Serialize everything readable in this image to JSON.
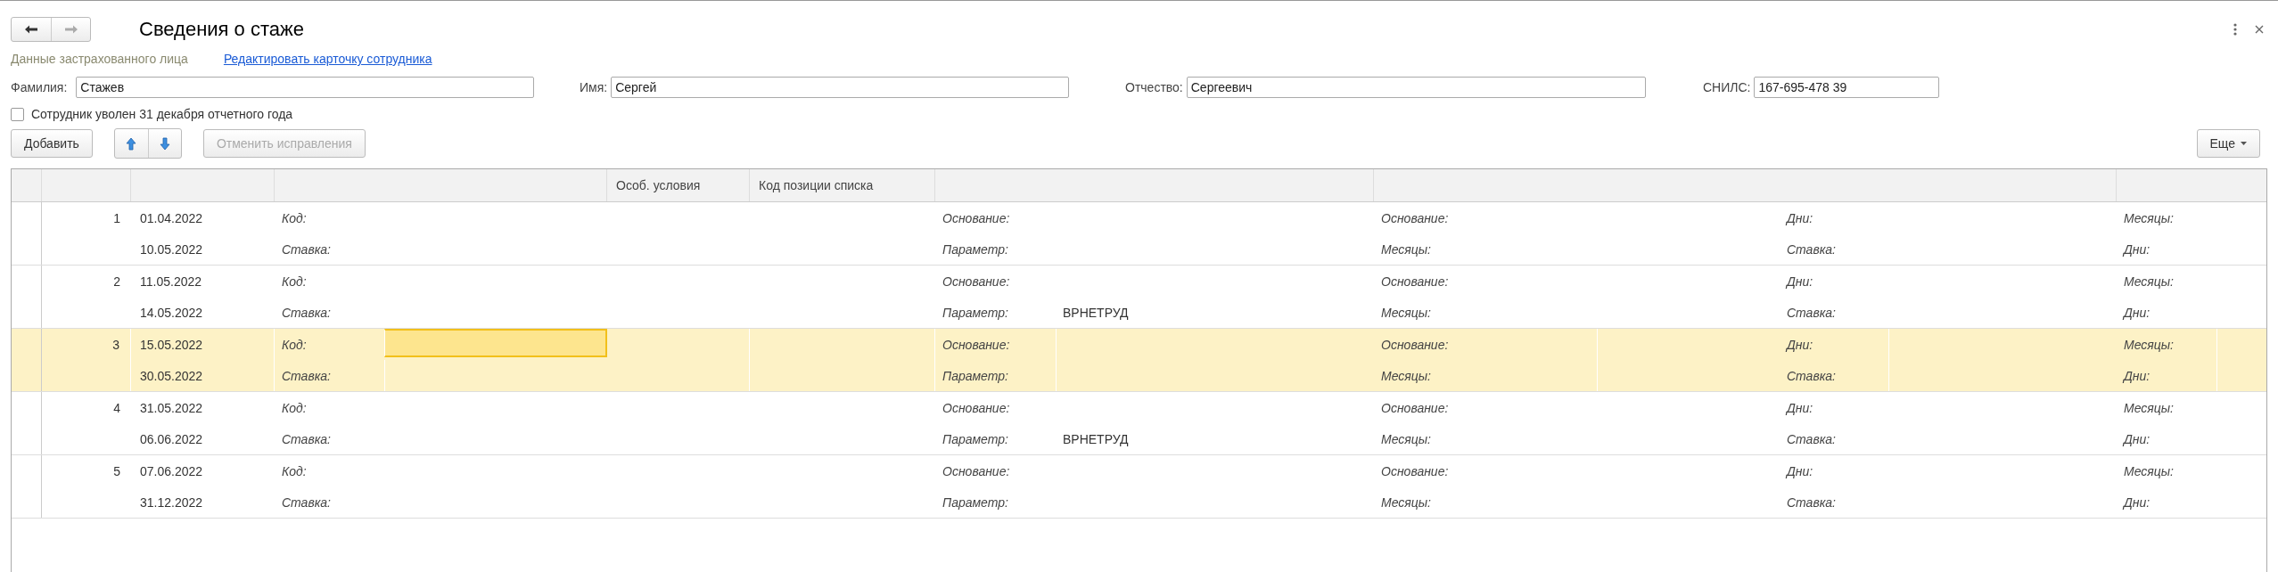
{
  "nav_buttons": [
    {
      "kind": "back",
      "disabled": false
    },
    {
      "kind": "forward",
      "disabled": true
    }
  ],
  "window": {
    "title": "Сведения о стаже"
  },
  "section_label": "Данные застрахованного лица",
  "edit_link": "Редактировать карточку сотрудника",
  "fields": [
    {
      "label": "Фамилия:",
      "value": "Стажев",
      "kind": "wide"
    },
    {
      "label": "Имя:",
      "value": "Сергей",
      "kind": "wide"
    },
    {
      "label": "Отчество:",
      "value": "Сергеевич",
      "kind": "wide"
    },
    {
      "label": "СНИЛС:",
      "value": "167-695-478 39",
      "kind": "short"
    }
  ],
  "dismissed_checkbox": {
    "label": "Сотрудник уволен 31 декабря отчетного года",
    "checked": false
  },
  "toolbar": {
    "add_button": {
      "label": "Добавить",
      "disabled": false
    },
    "move_buttons": [
      {
        "kind": "up",
        "disabled": false
      },
      {
        "kind": "down",
        "disabled": false
      }
    ],
    "cancel_button": {
      "label": "Отменить исправления",
      "disabled": true
    },
    "more_button": {
      "label": "Еще"
    }
  },
  "table": {
    "columns": [
      {
        "label": "Особ. условия"
      },
      {
        "label": "Код позиции списка"
      }
    ],
    "rows": [
      {
        "number": "1",
        "start": "01.04.2022",
        "end": "10.05.2022",
        "selected": false,
        "editing_code": false,
        "line_1": [
          {
            "label": "Код:"
          },
          {
            "label": "Основание:"
          },
          {
            "label": "Основание:"
          },
          {
            "label": "Дни:"
          },
          {
            "label": "Месяцы:"
          }
        ],
        "line_2": [
          {
            "label": "Ставка:"
          },
          {
            "label": "Параметр:"
          },
          {
            "label": "Месяцы:"
          },
          {
            "label": "Ставка:"
          },
          {
            "label": "Дни:"
          }
        ]
      },
      {
        "number": "2",
        "start": "11.05.2022",
        "end": "14.05.2022",
        "selected": false,
        "editing_code": false,
        "line_1": [
          {
            "label": "Код:"
          },
          {
            "label": "Основание:"
          },
          {
            "label": "Основание:"
          },
          {
            "label": "Дни:"
          },
          {
            "label": "Месяцы:"
          }
        ],
        "line_2": [
          {
            "label": "Ставка:"
          },
          {
            "label": "Параметр:",
            "value": "ВРНЕТРУД"
          },
          {
            "label": "Месяцы:"
          },
          {
            "label": "Ставка:"
          },
          {
            "label": "Дни:"
          }
        ]
      },
      {
        "number": "3",
        "start": "15.05.2022",
        "end": "30.05.2022",
        "selected": true,
        "editing_code": true,
        "line_1": [
          {
            "label": "Код:"
          },
          {
            "label": "Основание:"
          },
          {
            "label": "Основание:"
          },
          {
            "label": "Дни:"
          },
          {
            "label": "Месяцы:"
          }
        ],
        "line_2": [
          {
            "label": "Ставка:"
          },
          {
            "label": "Параметр:"
          },
          {
            "label": "Месяцы:"
          },
          {
            "label": "Ставка:"
          },
          {
            "label": "Дни:"
          }
        ]
      },
      {
        "number": "4",
        "start": "31.05.2022",
        "end": "06.06.2022",
        "selected": false,
        "editing_code": false,
        "line_1": [
          {
            "label": "Код:"
          },
          {
            "label": "Основание:"
          },
          {
            "label": "Основание:"
          },
          {
            "label": "Дни:"
          },
          {
            "label": "Месяцы:"
          }
        ],
        "line_2": [
          {
            "label": "Ставка:"
          },
          {
            "label": "Параметр:",
            "value": "ВРНЕТРУД"
          },
          {
            "label": "Месяцы:"
          },
          {
            "label": "Ставка:"
          },
          {
            "label": "Дни:"
          }
        ]
      },
      {
        "number": "5",
        "start": "07.06.2022",
        "end": "31.12.2022",
        "selected": false,
        "editing_code": false,
        "line_1": [
          {
            "label": "Код:"
          },
          {
            "label": "Основание:"
          },
          {
            "label": "Основание:"
          },
          {
            "label": "Дни:"
          },
          {
            "label": "Месяцы:"
          }
        ],
        "line_2": [
          {
            "label": "Ставка:"
          },
          {
            "label": "Параметр:"
          },
          {
            "label": "Месяцы:"
          },
          {
            "label": "Ставка:"
          },
          {
            "label": "Дни:"
          }
        ]
      }
    ]
  }
}
